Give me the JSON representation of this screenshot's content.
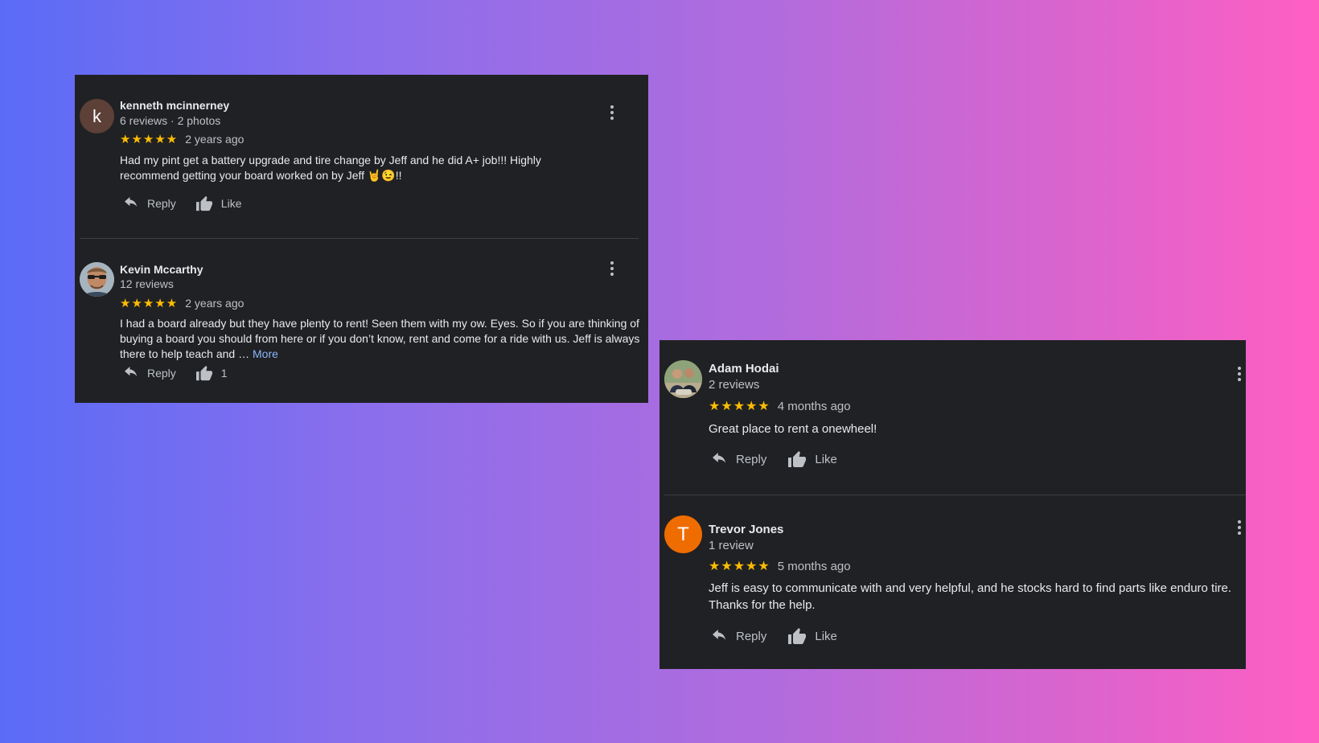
{
  "colors": {
    "panel_background": "#202124",
    "star": "#fbbc04",
    "link": "#8ab4f8",
    "secondary_text": "#bdc1c6"
  },
  "left_panel": {
    "reviews": [
      {
        "author": "kenneth mcinnerney",
        "avatar_letter": "k",
        "avatar_color": "#5d4037",
        "meta": "6 reviews · 2 photos",
        "stars": "★★★★★",
        "rating": 5,
        "time": "2 years ago",
        "text": "Had my pint get a battery upgrade and tire change by Jeff and he did A+ job!!! Highly recommend getting your board worked on by Jeff 🤘😉!!",
        "reply_label": "Reply",
        "like_label": "Like"
      },
      {
        "author": "Kevin Mccarthy",
        "avatar": "photo-avatar",
        "meta": "12 reviews",
        "stars": "★★★★★",
        "rating": 5,
        "time": "2 years ago",
        "text": "I had a board already but they have plenty to rent! Seen them with my ow. Eyes. So if you are thinking of buying a board you should from here or if you don’t know, rent and come for a ride with us. Jeff is always there to help teach and … ",
        "more_label": "More",
        "reply_label": "Reply",
        "like_label": "1"
      }
    ]
  },
  "right_panel": {
    "reviews": [
      {
        "author": "Adam Hodai",
        "avatar": "photo-avatar",
        "meta": "2 reviews",
        "stars": "★★★★★",
        "rating": 5,
        "time": "4 months ago",
        "text": "Great place to rent a onewheel!",
        "reply_label": "Reply",
        "like_label": "Like"
      },
      {
        "author": "Trevor Jones",
        "avatar_letter": "T",
        "avatar_color": "#ef6c00",
        "meta": "1 review",
        "stars": "★★★★★",
        "rating": 5,
        "time": "5 months ago",
        "text": "Jeff is easy to communicate with and very helpful, and he stocks hard to find parts like enduro tire. Thanks for the help.",
        "reply_label": "Reply",
        "like_label": "Like"
      }
    ]
  },
  "icons": [
    "reply-icon",
    "thumbs-up-icon",
    "more-options-icon"
  ]
}
